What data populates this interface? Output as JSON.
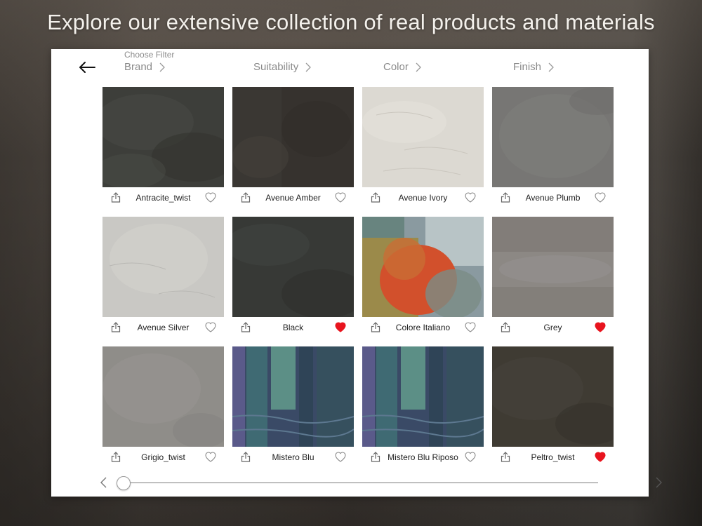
{
  "headline": "Explore our extensive collection of real products and materials",
  "filters": {
    "choose_label": "Choose Filter",
    "items": [
      "Brand",
      "Suitability",
      "Color",
      "Finish"
    ]
  },
  "materials": [
    {
      "name": "Antracite_twist",
      "favorite": false,
      "swatch": "charcoal"
    },
    {
      "name": "Avenue Amber",
      "favorite": false,
      "swatch": "dark-brown-grey"
    },
    {
      "name": "Avenue Ivory",
      "favorite": false,
      "swatch": "ivory"
    },
    {
      "name": "Avenue Plumb",
      "favorite": false,
      "swatch": "mid-grey"
    },
    {
      "name": "Avenue Silver",
      "favorite": false,
      "swatch": "light-grey"
    },
    {
      "name": "Black",
      "favorite": true,
      "swatch": "black-grey"
    },
    {
      "name": "Colore Italiano",
      "favorite": false,
      "swatch": "multicolor-painted"
    },
    {
      "name": "Grey",
      "favorite": true,
      "swatch": "warm-grey"
    },
    {
      "name": "Grigio_twist",
      "favorite": false,
      "swatch": "stone-grey"
    },
    {
      "name": "Mistero Blu",
      "favorite": false,
      "swatch": "blue-teal-streaks"
    },
    {
      "name": "Mistero Blu Riposo",
      "favorite": false,
      "swatch": "blue-teal-streaks"
    },
    {
      "name": "Peltro_twist",
      "favorite": true,
      "swatch": "dark-olive-brown"
    }
  ],
  "colors": {
    "favorite": "#e8141e",
    "heart_outline": "#8a8a8a",
    "panel": "#ffffff"
  },
  "slider": {
    "position": 0
  }
}
